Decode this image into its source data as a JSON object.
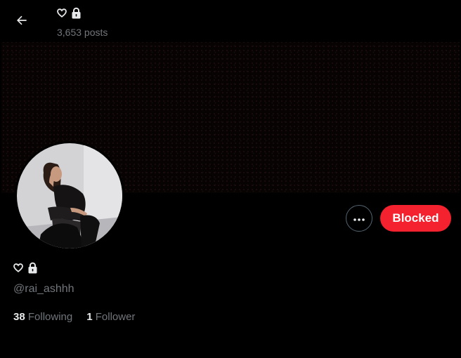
{
  "header": {
    "posts_count": "3,653 posts",
    "title_icons": [
      "heart-outline-icon",
      "lock-icon"
    ]
  },
  "profile": {
    "name_icons": [
      "heart-outline-icon",
      "lock-icon"
    ],
    "handle": "@rai_ashhh",
    "following_count": "38",
    "following_label": "Following",
    "follower_count": "1",
    "follower_label": "Follower"
  },
  "actions": {
    "more_icon": "ellipsis-icon",
    "blocked_label": "Blocked",
    "blocked_color": "#f4212e"
  },
  "colors": {
    "background": "#000000",
    "text_primary": "#e7e9ea",
    "text_secondary": "#71767b",
    "border": "#536471"
  }
}
